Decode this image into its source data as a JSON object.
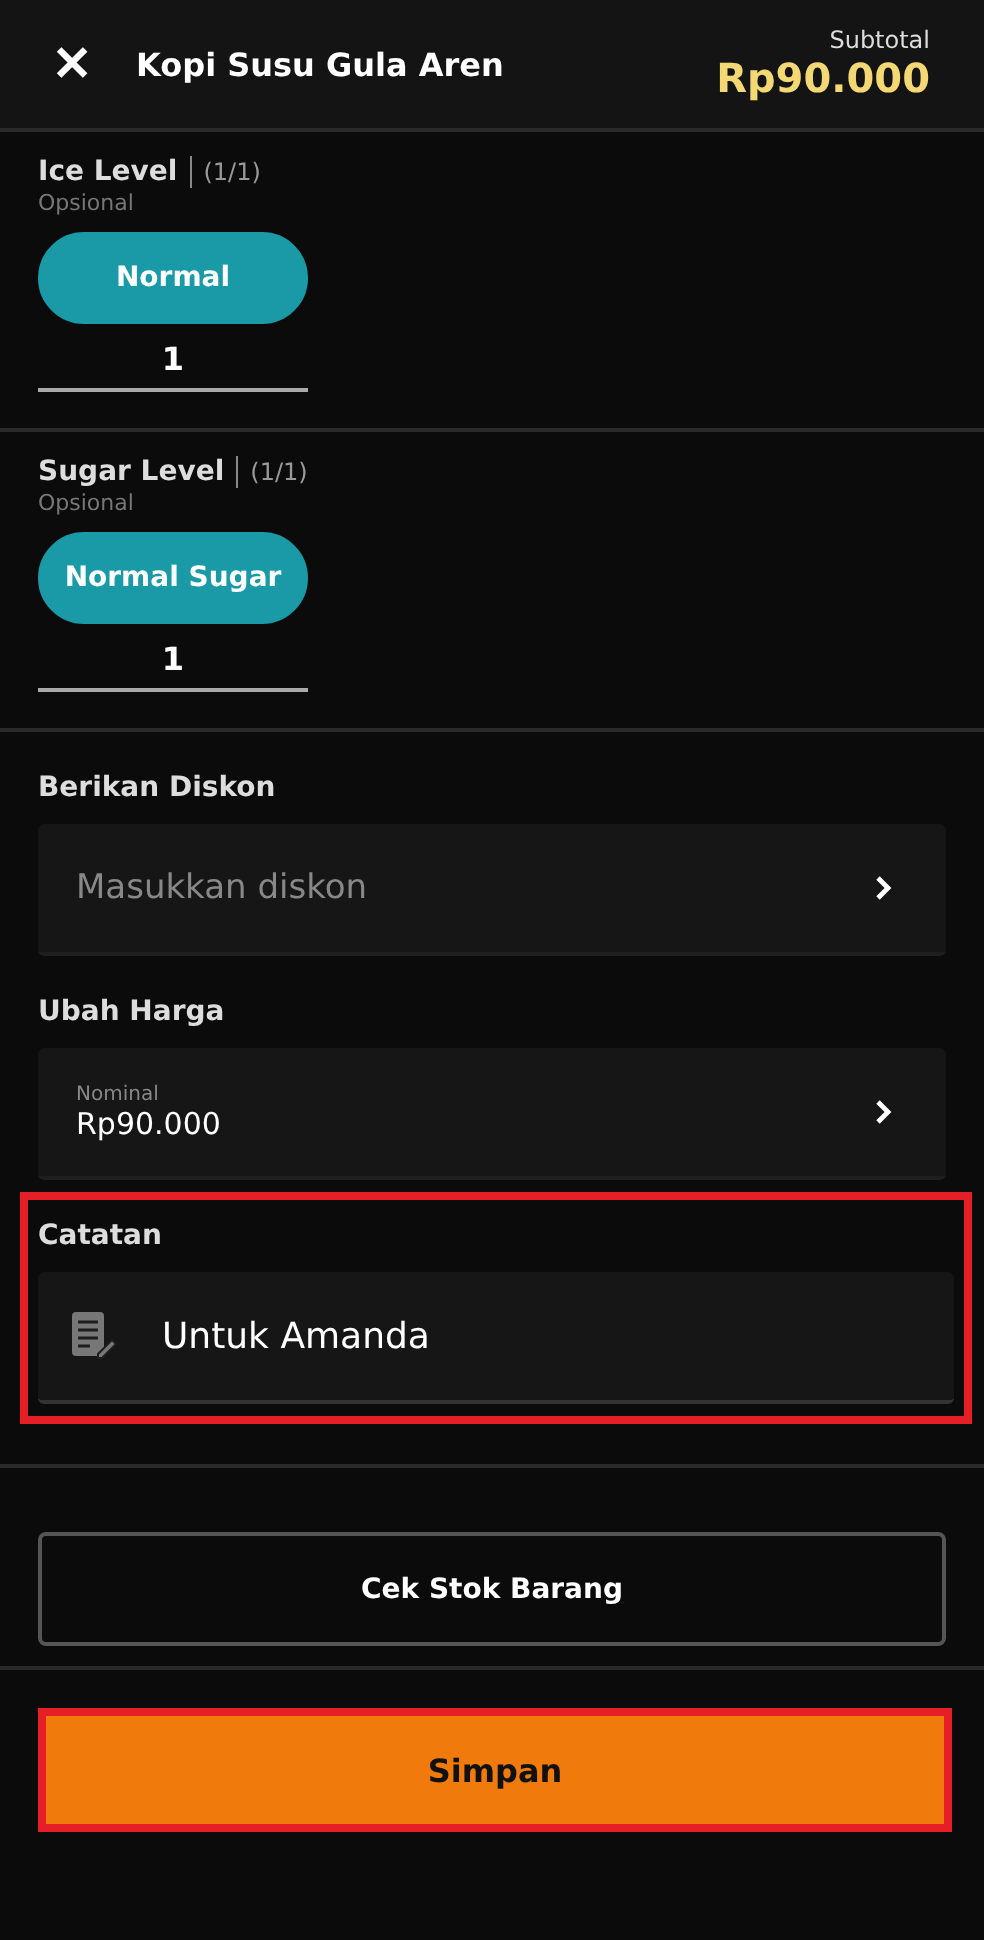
{
  "header": {
    "close_icon": "✕",
    "title": "Kopi Susu Gula Aren",
    "subtotal_label": "Subtotal",
    "subtotal": "Rp90.000"
  },
  "modifier_groups": [
    {
      "name": "Ice Level",
      "count": "(1/1)",
      "hint": "Opsional",
      "options": [
        {
          "label": "Normal",
          "selected": true,
          "quantity": "1"
        }
      ]
    },
    {
      "name": "Sugar Level",
      "count": "(1/1)",
      "hint": "Opsional",
      "options": [
        {
          "label": "Normal Sugar",
          "selected": true,
          "quantity": "1"
        }
      ]
    }
  ],
  "discount": {
    "label": "Berikan Diskon",
    "placeholder": "Masukkan diskon"
  },
  "price": {
    "label": "Ubah Harga",
    "field_label": "Nominal",
    "value": "Rp90.000"
  },
  "notes": {
    "label": "Catatan",
    "value": "Untuk Amanda",
    "highlighted": true
  },
  "check_stock_button": "Cek Stok Barang",
  "save_button": {
    "label": "Simpan",
    "highlighted": true
  }
}
